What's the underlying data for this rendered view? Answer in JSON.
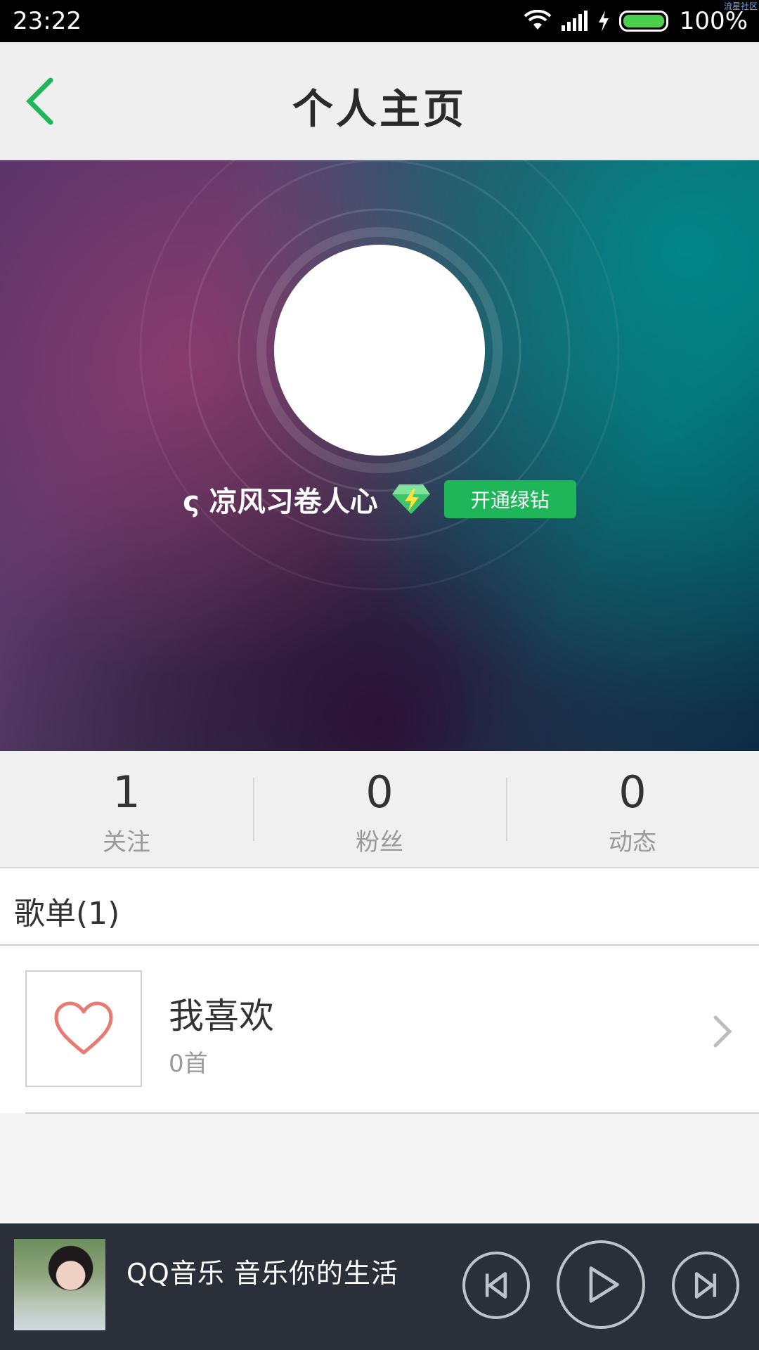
{
  "status_bar": {
    "time": "23:22",
    "battery": "100%",
    "watermark": "流星社区",
    "icons": [
      "wifi-icon",
      "signal-icon",
      "charge-icon",
      "battery-icon"
    ]
  },
  "header": {
    "title": "个人主页",
    "back_icon": "chevron-left-icon"
  },
  "profile": {
    "name": "ς 凉风习卷人心",
    "vip_button": "开通绿钻",
    "vip_icon": "green-diamond-icon"
  },
  "stats": [
    {
      "value": "1",
      "label": "关注"
    },
    {
      "value": "0",
      "label": "粉丝"
    },
    {
      "value": "0",
      "label": "动态"
    }
  ],
  "playlists": {
    "header": "歌单(1)",
    "items": [
      {
        "title": "我喜欢",
        "count": "0首",
        "icon": "heart-icon"
      }
    ]
  },
  "player": {
    "text": "QQ音乐 音乐你的生活",
    "controls": [
      "previous-icon",
      "play-icon",
      "next-icon"
    ]
  },
  "colors": {
    "accent": "#1fb65a",
    "player_bg": "#2b2f3a",
    "heart": "#e97a72"
  }
}
